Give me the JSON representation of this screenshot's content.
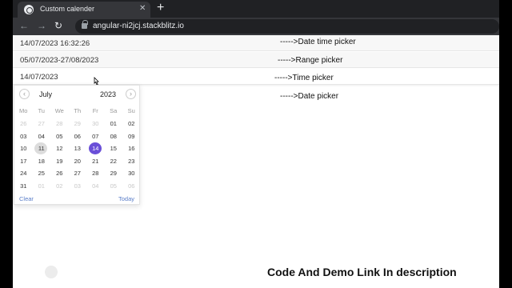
{
  "browser": {
    "tab_title": "Custom calender",
    "url": "angular-ni2jcj.stackblitz.io",
    "close_glyph": "✕",
    "new_tab_glyph": "+",
    "back_glyph": "←",
    "forward_glyph": "→",
    "reload_glyph": "↻"
  },
  "fields": [
    {
      "value": "14/07/2023 16:32:26",
      "note": "----->Date time picker"
    },
    {
      "value": "05/07/2023-27/08/2023",
      "note": "----->Range picker"
    },
    {
      "value": "14/07/2023",
      "note": "----->Time picker"
    }
  ],
  "date_picker_note": "----->Date picker",
  "calendar": {
    "month": "July",
    "year": "2023",
    "prev_glyph": "‹",
    "next_glyph": "›",
    "weekdays": [
      "Mo",
      "Tu",
      "We",
      "Th",
      "Fr",
      "Sa",
      "Su"
    ],
    "days": [
      {
        "d": "26",
        "m": true
      },
      {
        "d": "27",
        "m": true
      },
      {
        "d": "28",
        "m": true
      },
      {
        "d": "29",
        "m": true
      },
      {
        "d": "30",
        "m": true
      },
      {
        "d": "01"
      },
      {
        "d": "02"
      },
      {
        "d": "03"
      },
      {
        "d": "04"
      },
      {
        "d": "05"
      },
      {
        "d": "06"
      },
      {
        "d": "07"
      },
      {
        "d": "08"
      },
      {
        "d": "09"
      },
      {
        "d": "10"
      },
      {
        "d": "11",
        "today": true
      },
      {
        "d": "12"
      },
      {
        "d": "13"
      },
      {
        "d": "14",
        "sel": true
      },
      {
        "d": "15"
      },
      {
        "d": "16"
      },
      {
        "d": "17"
      },
      {
        "d": "18"
      },
      {
        "d": "19"
      },
      {
        "d": "20"
      },
      {
        "d": "21"
      },
      {
        "d": "22"
      },
      {
        "d": "23"
      },
      {
        "d": "24"
      },
      {
        "d": "25"
      },
      {
        "d": "26"
      },
      {
        "d": "27"
      },
      {
        "d": "28"
      },
      {
        "d": "29"
      },
      {
        "d": "30"
      },
      {
        "d": "31"
      },
      {
        "d": "01",
        "m": true
      },
      {
        "d": "02",
        "m": true
      },
      {
        "d": "03",
        "m": true
      },
      {
        "d": "04",
        "m": true
      },
      {
        "d": "05",
        "m": true
      },
      {
        "d": "06",
        "m": true
      }
    ],
    "clear_label": "Clear",
    "today_label": "Today",
    "selected_color": "#6a4fd8"
  },
  "caption": "Code And Demo Link In description"
}
